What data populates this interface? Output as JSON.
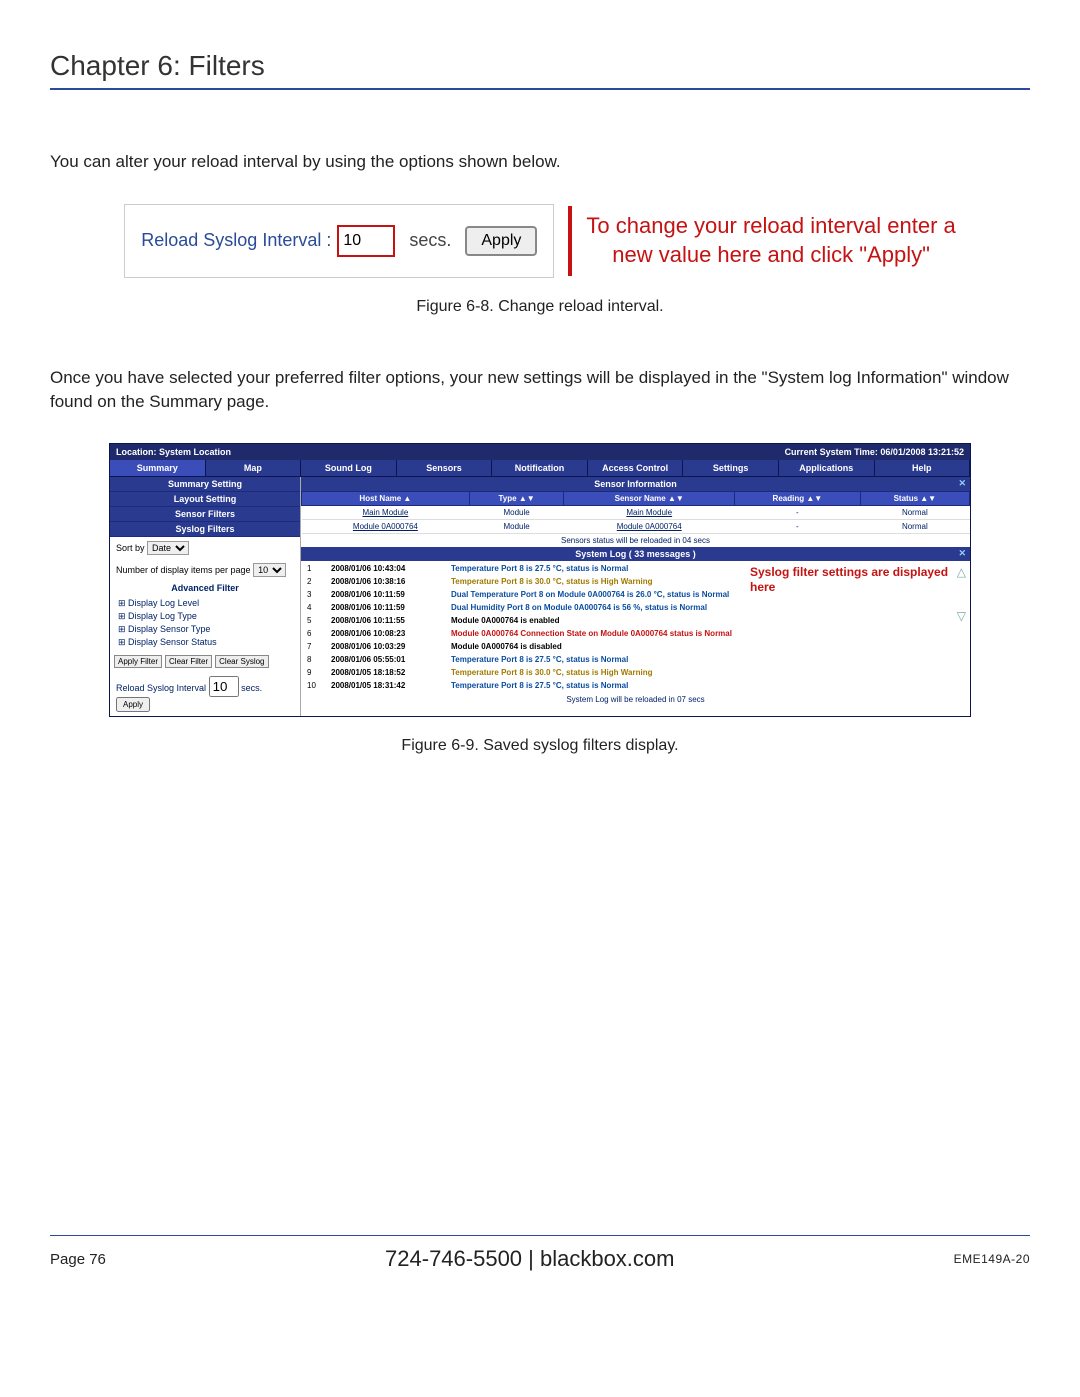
{
  "chapter_title": "Chapter 6: Filters",
  "para1": "You can alter your reload interval by using the options shown below.",
  "fig68": {
    "label": "Reload Syslog Interval :",
    "value": "10",
    "secs": "secs.",
    "apply": "Apply",
    "annot_line1": "To change your reload interval enter a",
    "annot_line2": "new value here and click \"Apply\"",
    "caption": "Figure 6-8. Change reload interval."
  },
  "para2": "Once you have selected your preferred filter options, your new settings will be displayed in the \"System log Information\" window found on the Summary page.",
  "fig69": {
    "location": "Location: System Location",
    "systime": "Current System Time: 06/01/2008 13:21:52",
    "tabs": [
      "Summary",
      "Map",
      "Sound Log",
      "Sensors",
      "Notification",
      "Access Control",
      "Settings",
      "Applications",
      "Help"
    ],
    "side_rows": [
      "Summary Setting",
      "Layout Setting",
      "Sensor Filters",
      "Syslog Filters"
    ],
    "sortby_label": "Sort by",
    "sortby_value": "Date",
    "items_label": "Number of display items per page",
    "items_value": "10",
    "adv_title": "Advanced Filter",
    "adv_items": [
      "Display Log Level",
      "Display Log Type",
      "Display Sensor Type",
      "Display Sensor Status"
    ],
    "btn_apply": "Apply Filter",
    "btn_clearf": "Clear Filter",
    "btn_clears": "Clear Syslog",
    "reload_label": "Reload Syslog Interval",
    "reload_value": "10",
    "reload_secs": "secs.",
    "reload_apply": "Apply",
    "sensor_bar": "Sensor Information",
    "sensor_headers": [
      "Host Name ▲",
      "Type ▲▼",
      "Sensor Name ▲▼",
      "Reading ▲▼",
      "Status ▲▼"
    ],
    "sensor_rows": [
      {
        "host": "Main Module",
        "type": "Module",
        "name": "Main Module",
        "reading": "-",
        "status": "Normal"
      },
      {
        "host": "Module 0A000764",
        "type": "Module",
        "name": "Module 0A000764",
        "reading": "-",
        "status": "Normal"
      }
    ],
    "sensor_note": "Sensors status will be reloaded in 04 secs",
    "syslog_bar": "System Log ( 33 messages )",
    "log_rows": [
      {
        "n": "1",
        "ts": "2008/01/06 10:43:04",
        "msg": "Temperature Port 8 is 27.5 °C, status is Normal",
        "cls": "msg-normal"
      },
      {
        "n": "2",
        "ts": "2008/01/06 10:38:16",
        "msg": "Temperature Port 8 is 30.0 °C, status is High Warning",
        "cls": "msg-warn"
      },
      {
        "n": "3",
        "ts": "2008/01/06 10:11:59",
        "msg": "Dual Temperature Port 8 on Module 0A000764 is 26.0 °C, status is Normal",
        "cls": "msg-normal"
      },
      {
        "n": "4",
        "ts": "2008/01/06 10:11:59",
        "msg": "Dual Humidity Port 8 on Module 0A000764 is 56 %, status is Normal",
        "cls": "msg-normal"
      },
      {
        "n": "5",
        "ts": "2008/01/06 10:11:55",
        "msg": "Module 0A000764 is enabled",
        "cls": "msg-plain"
      },
      {
        "n": "6",
        "ts": "2008/01/06 10:08:23",
        "msg": "Module 0A000764 Connection State on Module 0A000764 status is Normal",
        "cls": "msg-alert"
      },
      {
        "n": "7",
        "ts": "2008/01/06 10:03:29",
        "msg": "Module 0A000764 is disabled",
        "cls": "msg-plain"
      },
      {
        "n": "8",
        "ts": "2008/01/06 05:55:01",
        "msg": "Temperature Port 8 is 27.5 °C, status is Normal",
        "cls": "msg-normal"
      },
      {
        "n": "9",
        "ts": "2008/01/05 18:18:52",
        "msg": "Temperature Port 8 is 30.0 °C, status is High Warning",
        "cls": "msg-warn"
      },
      {
        "n": "10",
        "ts": "2008/01/05 18:31:42",
        "msg": "Temperature Port 8 is 27.5 °C, status is Normal",
        "cls": "msg-normal"
      }
    ],
    "log_footer": "System Log will be reloaded in 07 secs",
    "annot_line1": "Syslog filter settings are displayed",
    "annot_line2": "here",
    "caption": "Figure 6-9. Saved syslog filters display."
  },
  "footer": {
    "page": "Page 76",
    "center": "724-746-5500   |   blackbox.com",
    "doc": "EME149A-20"
  }
}
